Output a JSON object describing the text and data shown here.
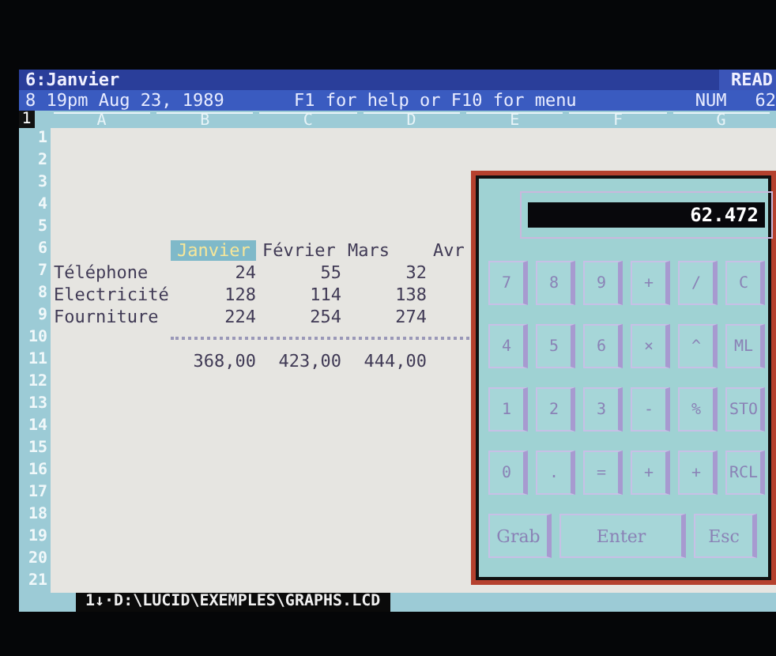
{
  "status_line": {
    "cell": "6:Janvier",
    "mode": "READ"
  },
  "info_line": {
    "clock": "8 19pm Aug 23, 1989",
    "hint": "F1 for help or F10 for menu",
    "lock": "NUM",
    "memory": "62"
  },
  "sheet": {
    "corner": "1",
    "columns": [
      "A",
      "B",
      "C",
      "D",
      "E",
      "F",
      "G"
    ],
    "rows": [
      {
        "number": "1",
        "kind": "blank"
      },
      {
        "number": "2",
        "kind": "blank"
      },
      {
        "number": "3",
        "kind": "blank"
      },
      {
        "number": "4",
        "kind": "blank"
      },
      {
        "number": "5",
        "kind": "blank"
      },
      {
        "number": "6",
        "kind": "header",
        "cells": [
          {
            "text": "Janvier",
            "selected": true
          },
          {
            "text": "Février",
            "selected": false
          },
          {
            "text": "Mars",
            "selected": false
          },
          {
            "text": "Avr",
            "selected": false
          }
        ]
      },
      {
        "number": "7",
        "kind": "data",
        "label": "Téléphone",
        "values": [
          "24",
          "55",
          "32"
        ]
      },
      {
        "number": "8",
        "kind": "data",
        "label": "Electricité",
        "values": [
          "128",
          "114",
          "138"
        ]
      },
      {
        "number": "9",
        "kind": "data",
        "label": "Fourniture",
        "values": [
          "224",
          "254",
          "274"
        ]
      },
      {
        "number": "10",
        "kind": "rule"
      },
      {
        "number": "11",
        "kind": "data",
        "values": [
          "368,00",
          "423,00",
          "444,00"
        ]
      },
      {
        "number": "12",
        "kind": "blank"
      },
      {
        "number": "13",
        "kind": "blank"
      },
      {
        "number": "14",
        "kind": "blank"
      },
      {
        "number": "15",
        "kind": "blank"
      },
      {
        "number": "16",
        "kind": "blank"
      },
      {
        "number": "17",
        "kind": "blank"
      },
      {
        "number": "18",
        "kind": "blank"
      },
      {
        "number": "19",
        "kind": "blank"
      },
      {
        "number": "20",
        "kind": "blank"
      },
      {
        "number": "21",
        "kind": "blank"
      }
    ],
    "file_path": "1↓·D:\\LUCID\\EXEMPLES\\GRAPHS.LCD"
  },
  "calculator": {
    "display": "62.472",
    "keys": [
      [
        "7",
        "8",
        "9",
        "+",
        "/",
        "C"
      ],
      [
        "4",
        "5",
        "6",
        "×",
        "^",
        "ML"
      ],
      [
        "1",
        "2",
        "3",
        "-",
        "%",
        "STO"
      ],
      [
        "0",
        ".",
        "=",
        "+",
        "+",
        "RCL"
      ]
    ],
    "actions": [
      "Grab",
      "Enter",
      "Esc"
    ]
  }
}
